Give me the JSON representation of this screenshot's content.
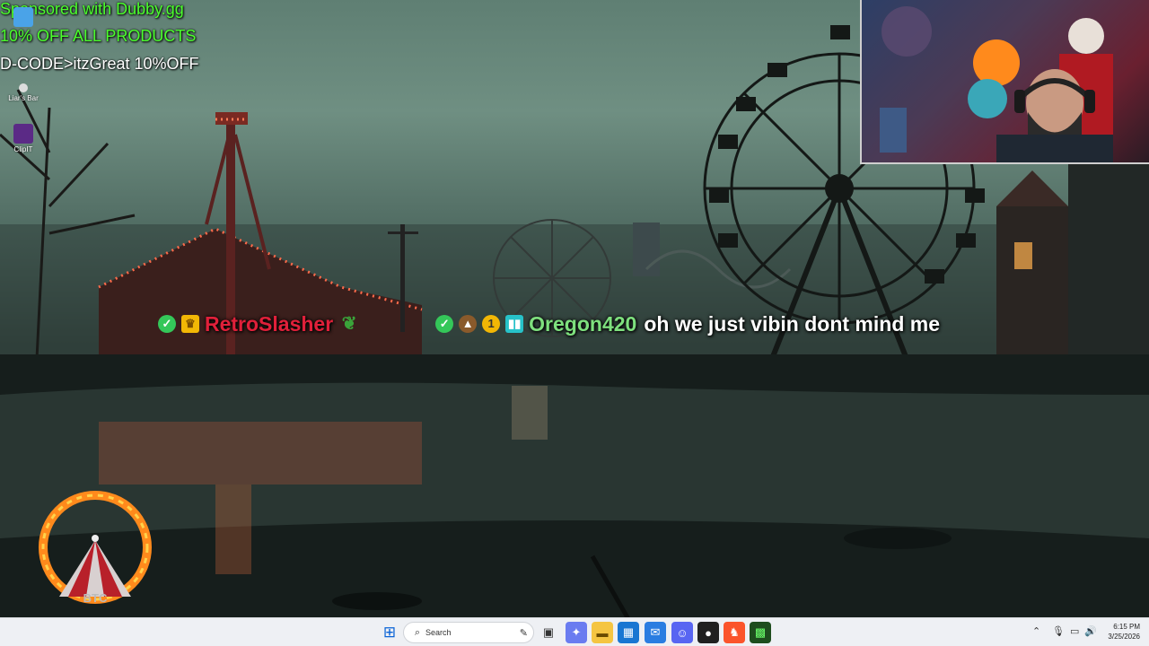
{
  "overlay": {
    "sponsor_line1": "Sponsored with Dubby.gg",
    "sponsor_line2": "10% OFF ALL PRODUCTS",
    "sponsor_line3": "D-CODE>itzGreat 10%OFF"
  },
  "desktop_icons": [
    {
      "label": "Liar's Bar"
    },
    {
      "label": "ClipIT"
    }
  ],
  "chat": {
    "user1": "RetroSlasher",
    "user2": "Oregon420",
    "message": "oh we just vibin dont mind me",
    "badge_one": "1"
  },
  "logo": {
    "text": "BTC"
  },
  "taskbar": {
    "search_label": "Search",
    "time": "6:15 PM",
    "date": "3/25/2026"
  },
  "colors": {
    "sponsor_green": "#4cff2e",
    "user1": "#e0203a",
    "user2": "#7ee07e",
    "taskbar_bg": "#eef0f4"
  }
}
